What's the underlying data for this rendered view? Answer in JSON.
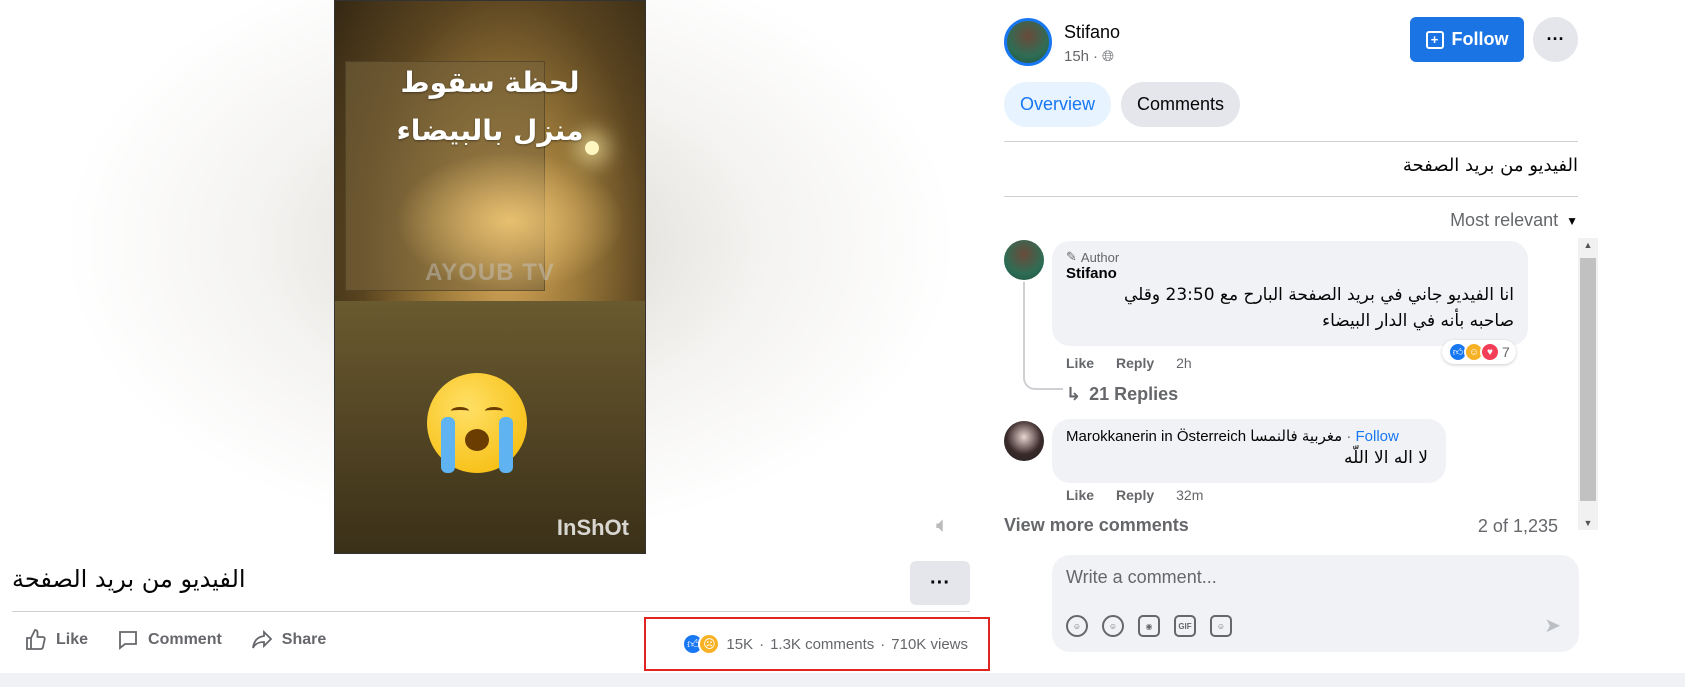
{
  "video": {
    "overlay_text_line1": "لحظة سقوط",
    "overlay_text_line2": "منزل بالبيضاء",
    "watermark": "AYOUB TV",
    "app_watermark": "InShOt",
    "emoji": "loudly-crying-face"
  },
  "post": {
    "title": "الفيديو من بريد الصفحة",
    "more_label": "···",
    "actions": {
      "like": "Like",
      "comment": "Comment",
      "share": "Share"
    },
    "stats": {
      "reactions": "15K",
      "comments": "1.3K comments",
      "views": "710K views",
      "separator": "·"
    }
  },
  "author": {
    "name": "Stifano",
    "time": "15h",
    "separator": "·",
    "follow_label": "Follow",
    "more_label": "···"
  },
  "tabs": [
    {
      "label": "Overview",
      "active": true
    },
    {
      "label": "Comments",
      "active": false
    }
  ],
  "description": "الفيديو من بريد الصفحة",
  "sort": {
    "label": "Most relevant"
  },
  "comments": [
    {
      "badge": "Author",
      "name": "Stifano",
      "text_line1": "انا الفيديو جاني في بريد الصفحة البارح مع 23:50 وقلي",
      "text_line2": "صاحبه بأنه في الدار البيضاء",
      "like": "Like",
      "reply": "Reply",
      "time": "2h",
      "reaction_count": "7",
      "replies_label": "21 Replies"
    },
    {
      "name": "Marokkanerin in Österreich مغربية فالنمسا",
      "follow_label": "Follow",
      "separator": "·",
      "text": "لا اله الا اللّه",
      "like": "Like",
      "reply": "Reply",
      "time": "32m"
    }
  ],
  "view_more": "View more comments",
  "comment_count": "2 of 1,235",
  "composer": {
    "placeholder": "Write a comment..."
  },
  "colors": {
    "accent": "#1877f2",
    "follow_bg": "#1b74e4",
    "highlight_box": "#e02424"
  }
}
